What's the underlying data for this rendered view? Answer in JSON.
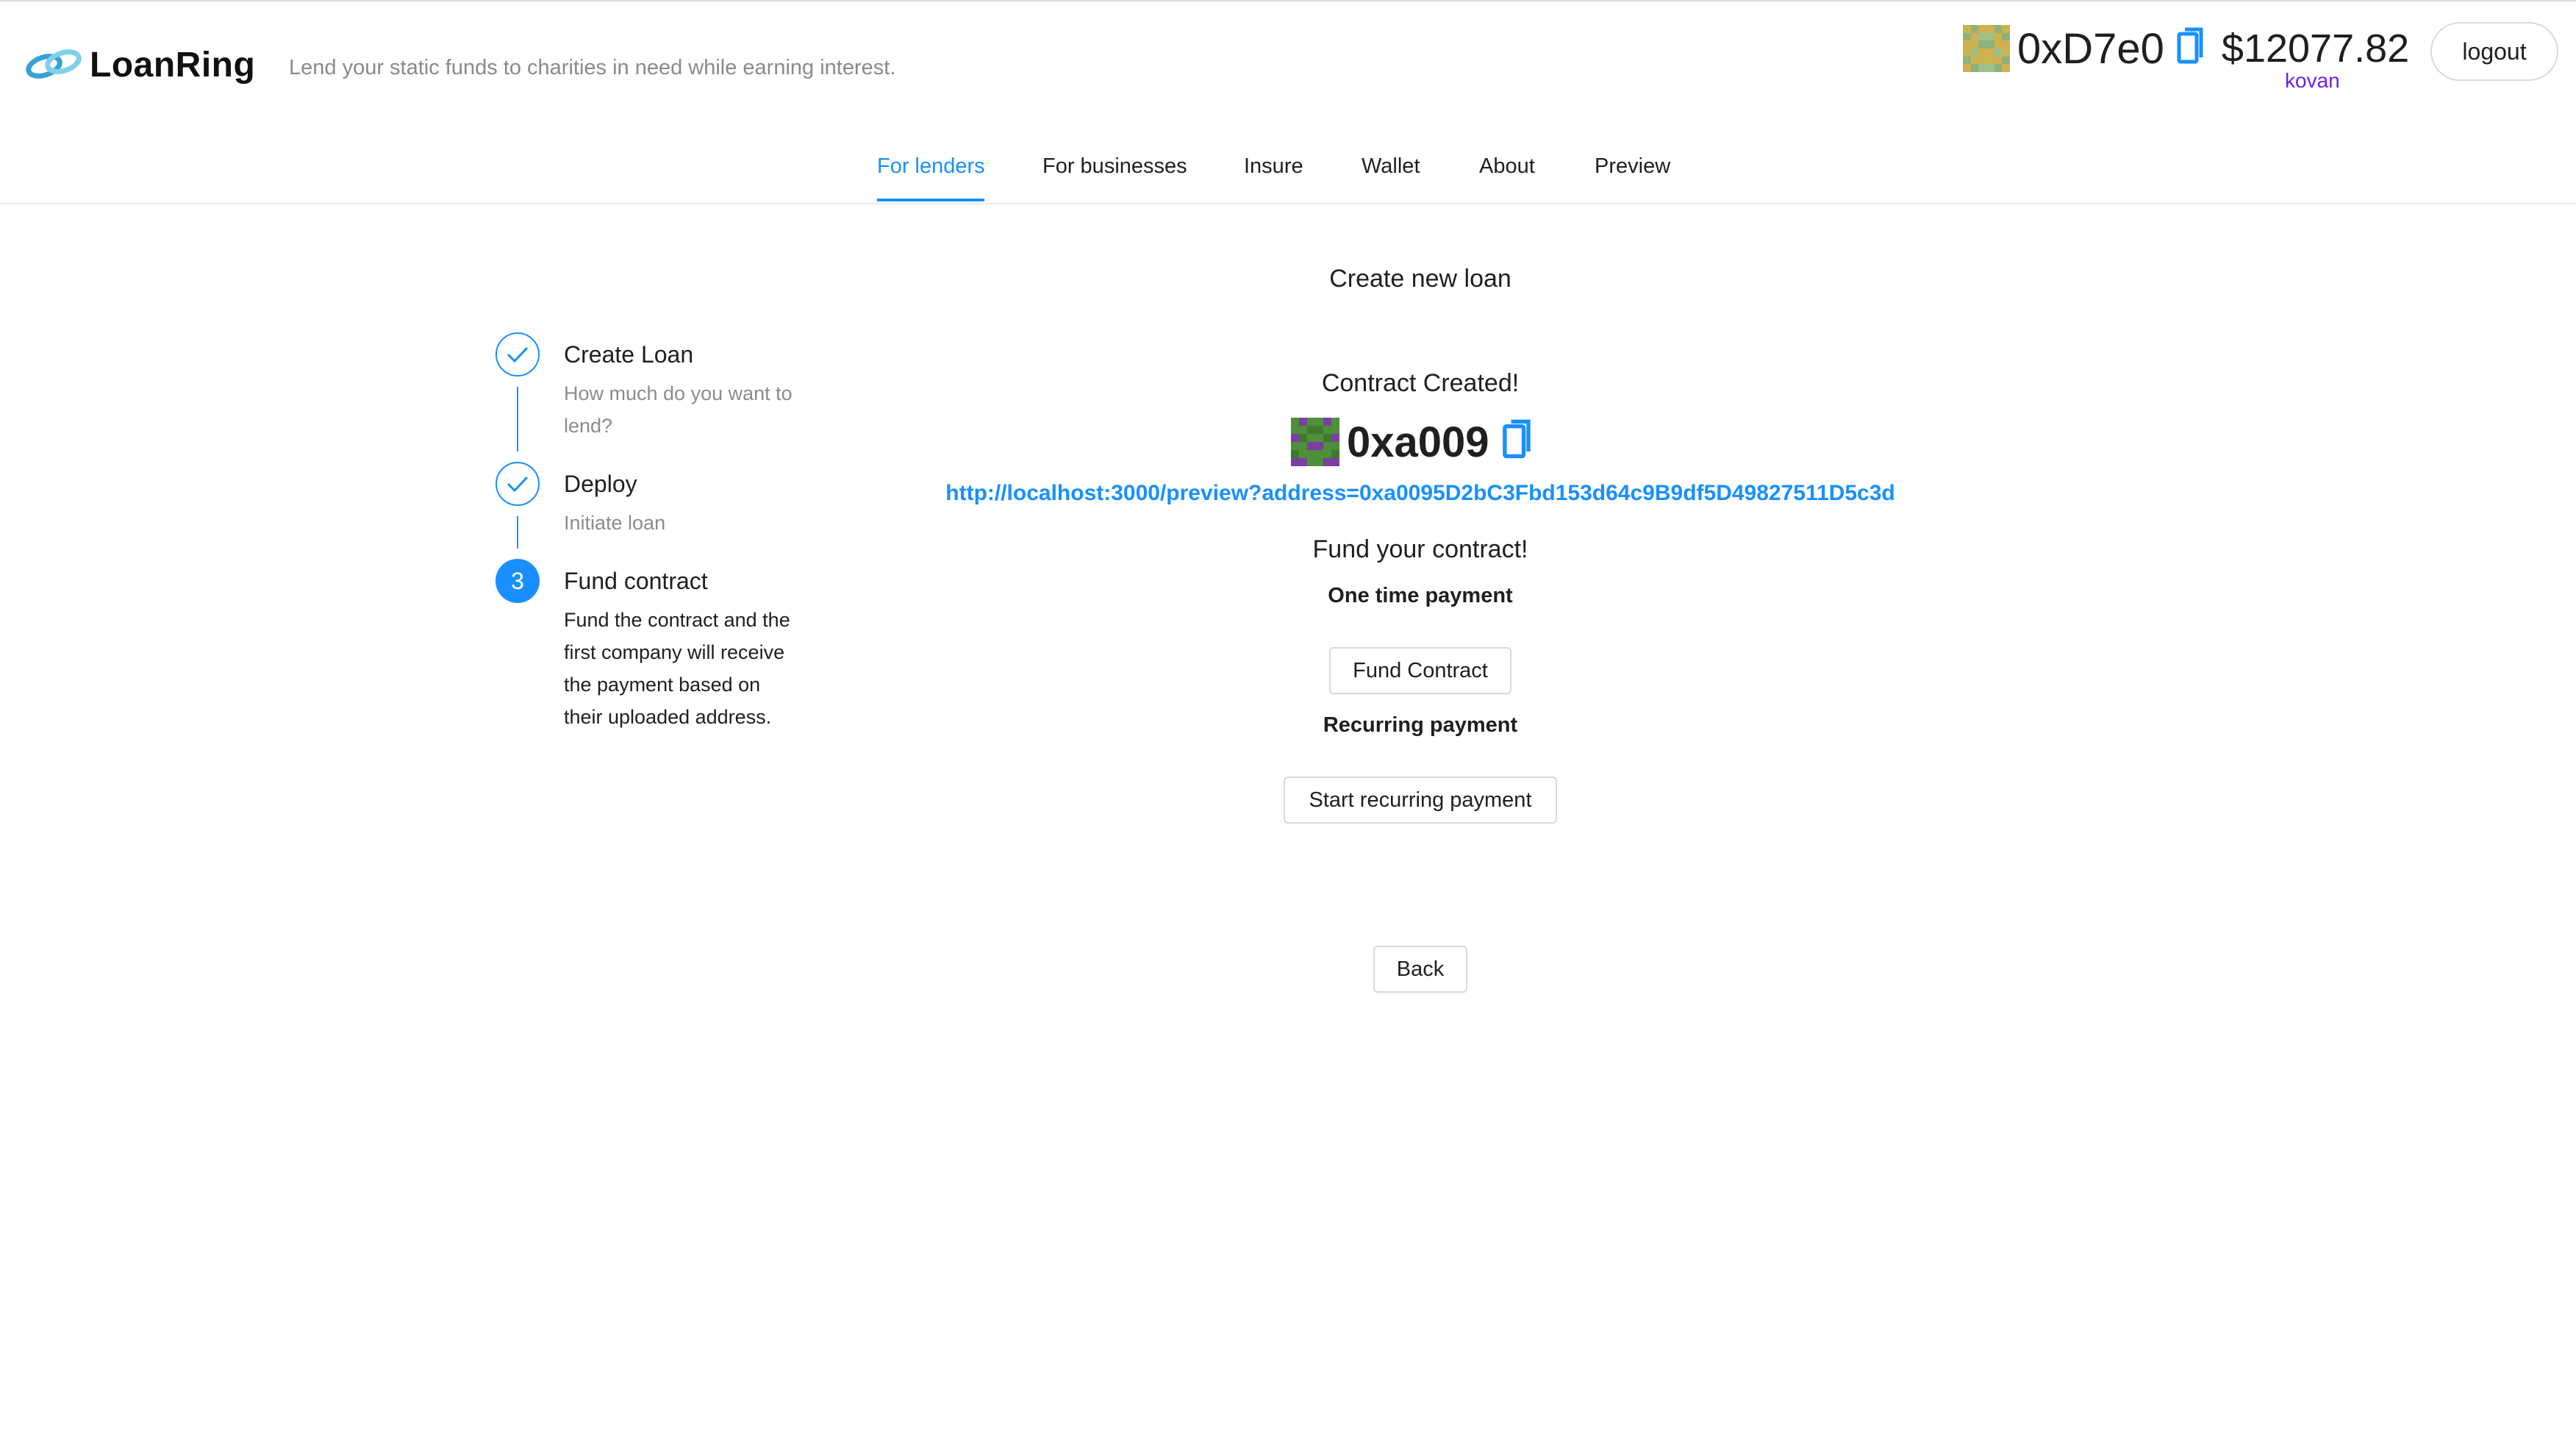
{
  "header": {
    "logo_text": "LoanRing",
    "tagline": "Lend your static funds to charities in need while earning interest.",
    "account_address": "0xD7e0",
    "balance": "$12077.82",
    "network": "kovan",
    "logout_label": "logout"
  },
  "nav": {
    "tabs": [
      {
        "label": "For lenders",
        "active": true
      },
      {
        "label": "For businesses",
        "active": false
      },
      {
        "label": "Insure",
        "active": false
      },
      {
        "label": "Wallet",
        "active": false
      },
      {
        "label": "About",
        "active": false
      },
      {
        "label": "Preview",
        "active": false
      }
    ]
  },
  "steps": [
    {
      "title": "Create Loan",
      "description": "How much do you want to lend?",
      "status": "done"
    },
    {
      "title": "Deploy",
      "description": "Initiate loan",
      "status": "done"
    },
    {
      "number": "3",
      "title": "Fund contract",
      "description": "Fund the contract and the first company will receive the payment based on their uploaded address.",
      "status": "current"
    }
  ],
  "main": {
    "title": "Create new loan",
    "created_label": "Contract Created!",
    "contract_address": "0xa009",
    "preview_url": "http://localhost:3000/preview?address=0xa0095D2bC3Fbd153d64c9B9df5D49827511D5c3d",
    "fund_heading": "Fund your contract!",
    "one_time_label": "One time payment",
    "fund_button": "Fund Contract",
    "recurring_label": "Recurring payment",
    "recurring_button": "Start recurring payment",
    "back_button": "Back"
  },
  "colors": {
    "accent": "#1890ff",
    "network": "#6b21e8"
  },
  "icons": [
    "loanring-logo-icon",
    "identicon",
    "copy-icon",
    "check-icon"
  ]
}
